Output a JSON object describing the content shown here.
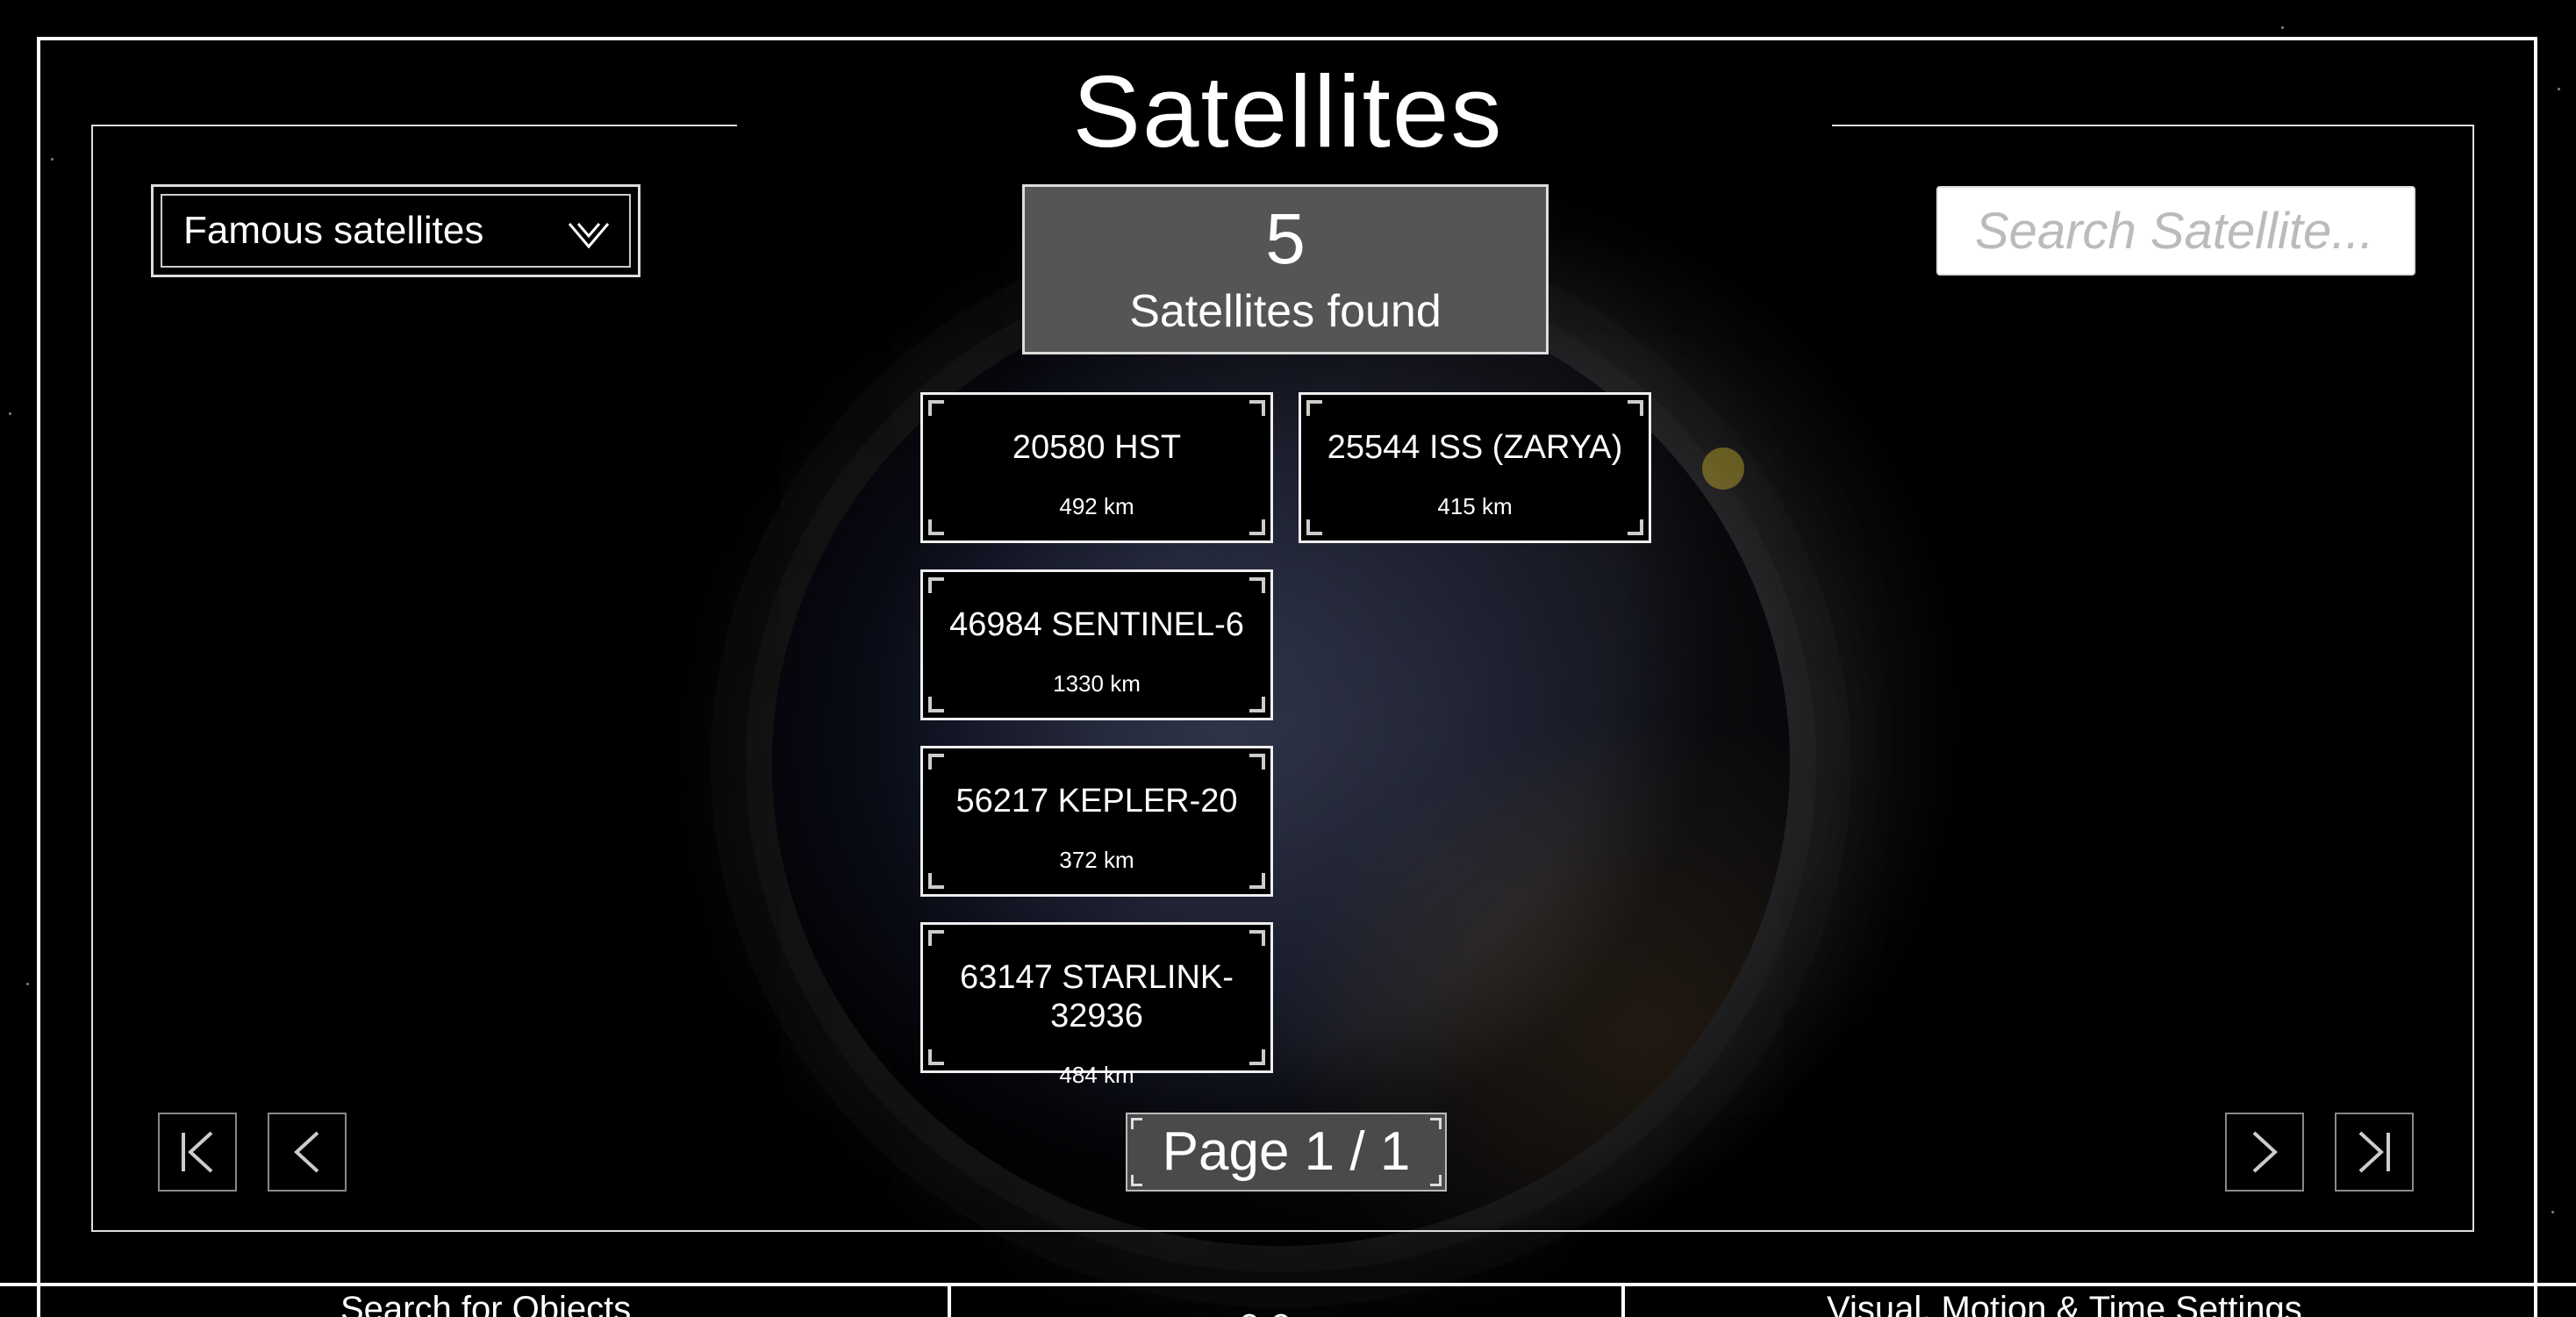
{
  "title": "Satellites",
  "filter": {
    "selected": "Famous satellites"
  },
  "summary": {
    "count": "5",
    "label": "Satellites found"
  },
  "search": {
    "placeholder": "Search Satellite..."
  },
  "results": [
    {
      "name": "20580 HST",
      "altitude": "492 km"
    },
    {
      "name": "25544 ISS (ZARYA)",
      "altitude": "415 km"
    },
    {
      "name": "46984 SENTINEL-6",
      "altitude": "1330 km"
    },
    {
      "name": "56217 KEPLER-20",
      "altitude": "372 km"
    },
    {
      "name": "63147 STARLINK-32936",
      "altitude": "484 km"
    }
  ],
  "pagination": {
    "label": "Page 1 / 1"
  },
  "bottom_tabs": [
    {
      "label": "Search for Objects"
    },
    {
      "label": "Visual, Motion & Time Settings"
    }
  ],
  "icons": {
    "dropdown": "chevron-double-down-icon",
    "first": "first-page-icon",
    "prev": "previous-page-icon",
    "next": "next-page-icon",
    "last": "last-page-icon"
  }
}
